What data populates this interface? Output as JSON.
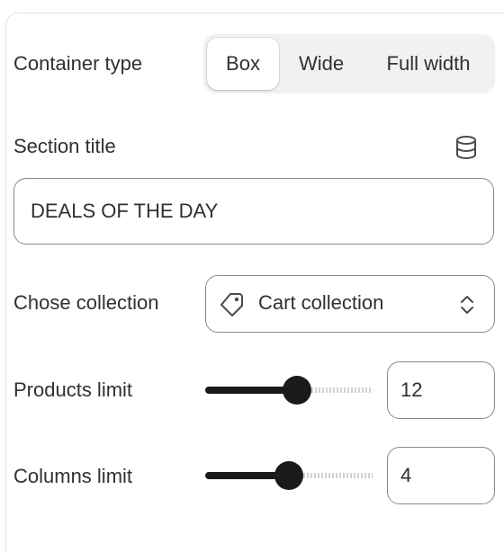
{
  "container_type": {
    "label": "Container type",
    "options": [
      "Box",
      "Wide",
      "Full width"
    ],
    "selected": "Box"
  },
  "section_title": {
    "label": "Section title",
    "value": "DEALS OF THE DAY",
    "icon": "database-icon"
  },
  "collection": {
    "label": "Chose collection",
    "value": "Cart collection",
    "icon": "tag-icon",
    "chevron_icon": "select-chevron-icon"
  },
  "products_limit": {
    "label": "Products limit",
    "value": "12",
    "slider_fraction": 0.55
  },
  "columns_limit": {
    "label": "Columns limit",
    "value": "4",
    "slider_fraction": 0.5
  },
  "colors": {
    "text": "#303030",
    "border": "#8a8a8a",
    "segment_bg": "#f1f1f1",
    "slider_fill": "#1a1a1a"
  }
}
